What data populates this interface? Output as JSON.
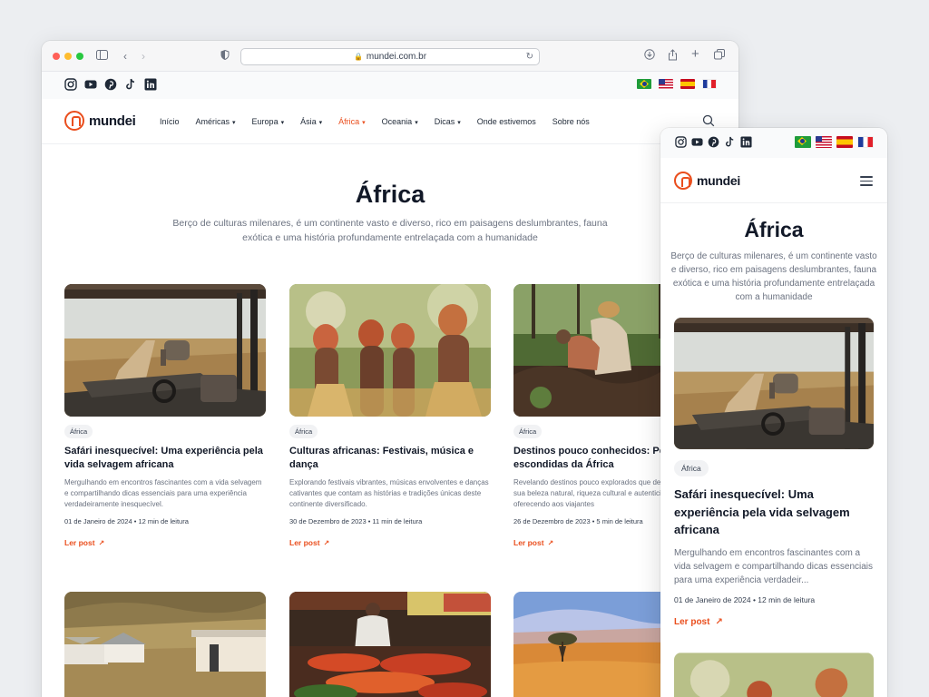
{
  "browser": {
    "url": "mundei.com.br"
  },
  "brand": {
    "name": "mundei",
    "accent": "#ea4e1d"
  },
  "social": [
    "instagram-icon",
    "youtube-icon",
    "pinterest-icon",
    "tiktok-icon",
    "linkedin-icon"
  ],
  "languages": [
    "pt-BR",
    "en-US",
    "es",
    "fr"
  ],
  "nav": {
    "items": [
      {
        "label": "Início",
        "dropdown": false,
        "active": false
      },
      {
        "label": "Américas",
        "dropdown": true,
        "active": false
      },
      {
        "label": "Europa",
        "dropdown": true,
        "active": false
      },
      {
        "label": "Ásia",
        "dropdown": true,
        "active": false
      },
      {
        "label": "África",
        "dropdown": true,
        "active": true
      },
      {
        "label": "Oceania",
        "dropdown": true,
        "active": false
      },
      {
        "label": "Dicas",
        "dropdown": true,
        "active": false
      },
      {
        "label": "Onde estivemos",
        "dropdown": false,
        "active": false
      },
      {
        "label": "Sobre nós",
        "dropdown": false,
        "active": false
      }
    ]
  },
  "page": {
    "title": "África",
    "description": "Berço de culturas milenares, é um continente vasto e diverso, rico em paisagens deslumbrantes, fauna exótica e uma história profundamente entrelaçada com a humanidade"
  },
  "posts": [
    {
      "tag": "África",
      "title": "Safári inesquecível: Uma experiência pela vida selvagem africana",
      "excerpt": "Mergulhando em encontros fascinantes com a vida selvagem e compartilhando dicas essenciais para uma experiência verdadeiramente inesquecível.",
      "excerpt_mobile": "Mergulhando em encontros fascinantes com a vida selvagem e compartilhando dicas essenciais para uma experiência verdadeir...",
      "meta": "01 de Janeiro de 2024 • 12 min de leitura",
      "cta": "Ler post"
    },
    {
      "tag": "África",
      "title": "Culturas africanas: Festivais, música e dança",
      "excerpt": "Explorando festivais vibrantes, músicas envolventes e danças cativantes que contam as histórias e tradições únicas deste continente diversificado.",
      "meta": "30 de Dezembro de 2023 • 11 min de leitura",
      "cta": "Ler post"
    },
    {
      "tag": "África",
      "title": "Destinos pouco conhecidos: Pérolas escondidas da África",
      "excerpt": "Revelando destinos pouco explorados que deslumbram com sua beleza natural, riqueza cultural e autenticidade, oferecendo aos viajantes",
      "meta": "26 de Dezembro de 2023 • 5 min de leitura",
      "cta": "Ler post"
    }
  ]
}
